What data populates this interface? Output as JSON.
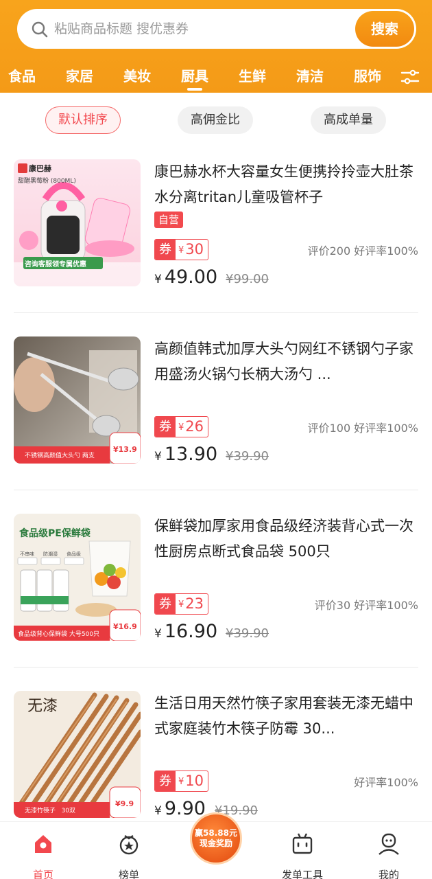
{
  "search": {
    "placeholder": "粘贴商品标题 搜优惠券",
    "button_label": "搜索"
  },
  "categories": [
    "食品",
    "家居",
    "美妆",
    "厨具",
    "生鲜",
    "清洁",
    "服饰"
  ],
  "active_category": "厨具",
  "sort_options": [
    "默认排序",
    "高佣金比",
    "高成单量"
  ],
  "active_sort": "默认排序",
  "products": [
    {
      "title": "康巴赫水杯大容量女生便携拎拎壶大肚茶水分离tritan儿童吸管杯子",
      "self_operated": "自营",
      "coupon_label": "券",
      "coupon_currency": "¥",
      "coupon_amount": "30",
      "rating": "评价200 好评率100%",
      "currency": "¥",
      "price": "49.00",
      "original_price": "¥99.00",
      "thumb_brand": "康巴赫",
      "thumb_name": "甜醋黑莓粉 (800ML)",
      "thumb_banner": "咨询客服领专属优惠"
    },
    {
      "title": "高颜值韩式加厚大头勺网红不锈钢勺子家用盛汤火锅勺长柄大汤勺 ...",
      "coupon_label": "券",
      "coupon_currency": "¥",
      "coupon_amount": "26",
      "rating": "评价100 好评率100%",
      "currency": "¥",
      "price": "13.90",
      "original_price": "¥39.90",
      "thumb_banner": "不锈钢高颜值大头勺 两支",
      "thumb_price": "¥13.9"
    },
    {
      "title": "保鲜袋加厚家用食品级经济装背心式一次性厨房点断式食品袋 500只",
      "coupon_label": "券",
      "coupon_currency": "¥",
      "coupon_amount": "23",
      "rating": "评价30 好评率100%",
      "currency": "¥",
      "price": "16.90",
      "original_price": "¥39.90",
      "thumb_headline": "食品级PE保鲜袋",
      "thumb_features": [
        "不串味",
        "防潮湿",
        "食品级"
      ],
      "thumb_banner": "食品级背心保鲜袋 大号500只",
      "thumb_price": "¥16.9"
    },
    {
      "title": "生活日用天然竹筷子家用套装无漆无蜡中式家庭装竹木筷子防霉 30...",
      "coupon_label": "券",
      "coupon_currency": "¥",
      "coupon_amount": "10",
      "rating": "好评率100%",
      "currency": "¥",
      "price": "9.90",
      "original_price": "¥19.90",
      "thumb_headline": "无漆",
      "thumb_banner": "无漆竹筷子   30双",
      "thumb_price": "¥9.9"
    }
  ],
  "tabbar": {
    "home": "首页",
    "rank": "榜单",
    "reward_line1": "赢58.88元",
    "reward_line2": "现金奖励",
    "tools": "发单工具",
    "mine": "我的"
  },
  "colors": {
    "brand_orange": "#f49a17",
    "accent_red": "#f0484e"
  }
}
